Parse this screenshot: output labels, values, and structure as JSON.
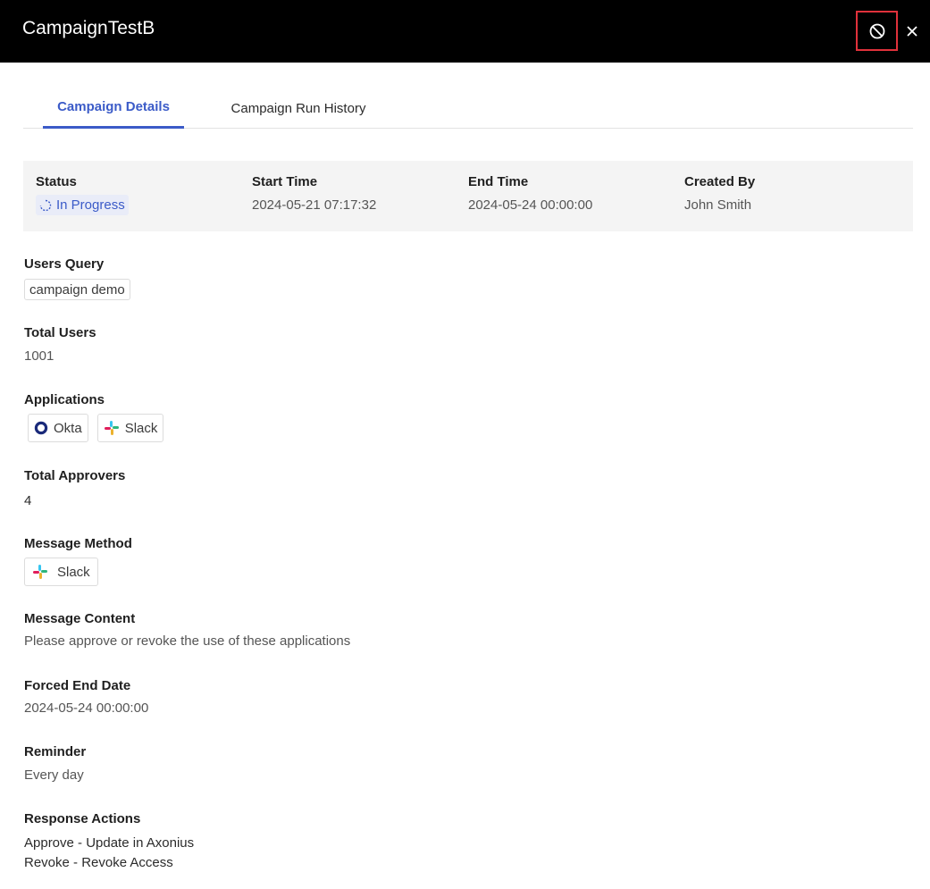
{
  "header": {
    "title": "CampaignTestB"
  },
  "tabs": [
    {
      "label": "Campaign Details",
      "active": true
    },
    {
      "label": "Campaign Run History",
      "active": false
    }
  ],
  "summary": {
    "status_label": "Status",
    "status_value": "In Progress",
    "start_label": "Start Time",
    "start_value": "2024-05-21 07:17:32",
    "end_label": "End Time",
    "end_value": "2024-05-24 00:00:00",
    "created_label": "Created By",
    "created_value": "John Smith"
  },
  "users_query": {
    "label": "Users Query",
    "value": "campaign demo"
  },
  "total_users": {
    "label": "Total Users",
    "value": "1001"
  },
  "applications": {
    "label": "Applications",
    "items": [
      "Okta",
      "Slack"
    ]
  },
  "total_approvers": {
    "label": "Total Approvers",
    "value": "4"
  },
  "message_method": {
    "label": "Message Method",
    "value": "Slack"
  },
  "message_content": {
    "label": "Message Content",
    "value": "Please approve or revoke the use of these applications"
  },
  "forced_end_date": {
    "label": "Forced End Date",
    "value": "2024-05-24 00:00:00"
  },
  "reminder": {
    "label": "Reminder",
    "value": "Every day"
  },
  "response_actions": {
    "label": "Response Actions",
    "items": [
      "Approve - Update in Axonius",
      "Revoke - Revoke Access"
    ]
  },
  "colors": {
    "accent": "#3b5bc8",
    "header_bg": "#000000",
    "highlight_border": "#e0313b",
    "okta": "#1a2a7a",
    "slack_blue": "#36c5f0",
    "slack_green": "#2eb67d",
    "slack_yellow": "#ecb22e",
    "slack_red": "#e01e5a"
  },
  "icons": {
    "stop": "stop-campaign-icon",
    "close": "close-icon",
    "status": "spinner-icon",
    "okta": "okta-icon",
    "slack": "slack-icon"
  }
}
